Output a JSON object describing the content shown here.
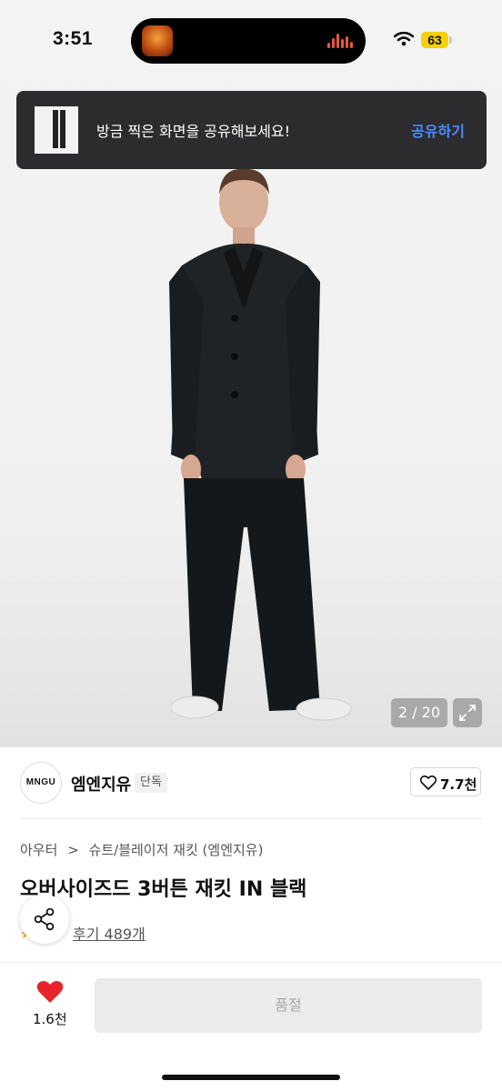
{
  "status_bar": {
    "time": "3:51",
    "battery": "63",
    "icons": [
      "wifi-icon",
      "battery-icon",
      "now-playing-thumbnail",
      "audio-waveform-icon"
    ]
  },
  "toast": {
    "message": "방금 찍은 화면을 공유해보세요!",
    "action": "공유하기",
    "action_color": "#4a8cff"
  },
  "gallery": {
    "counter": "2 / 20",
    "expand_icon": "expand-icon"
  },
  "brand": {
    "logo_text": "MNGU",
    "name": "엠엔지유",
    "badge": "단독",
    "like_count": "7.7천"
  },
  "breadcrumb": {
    "category": "아우터",
    "separator": ">",
    "subcategory": "슈트/블레이저 재킷 (엠엔지유)"
  },
  "product": {
    "title": "오버사이즈드 3버튼 재킷 IN 블랙",
    "reviews": "후기 489개"
  },
  "bottom_bar": {
    "favorite_count": "1.6천",
    "purchase_label": "품절",
    "heart_color": "#e8232b"
  }
}
